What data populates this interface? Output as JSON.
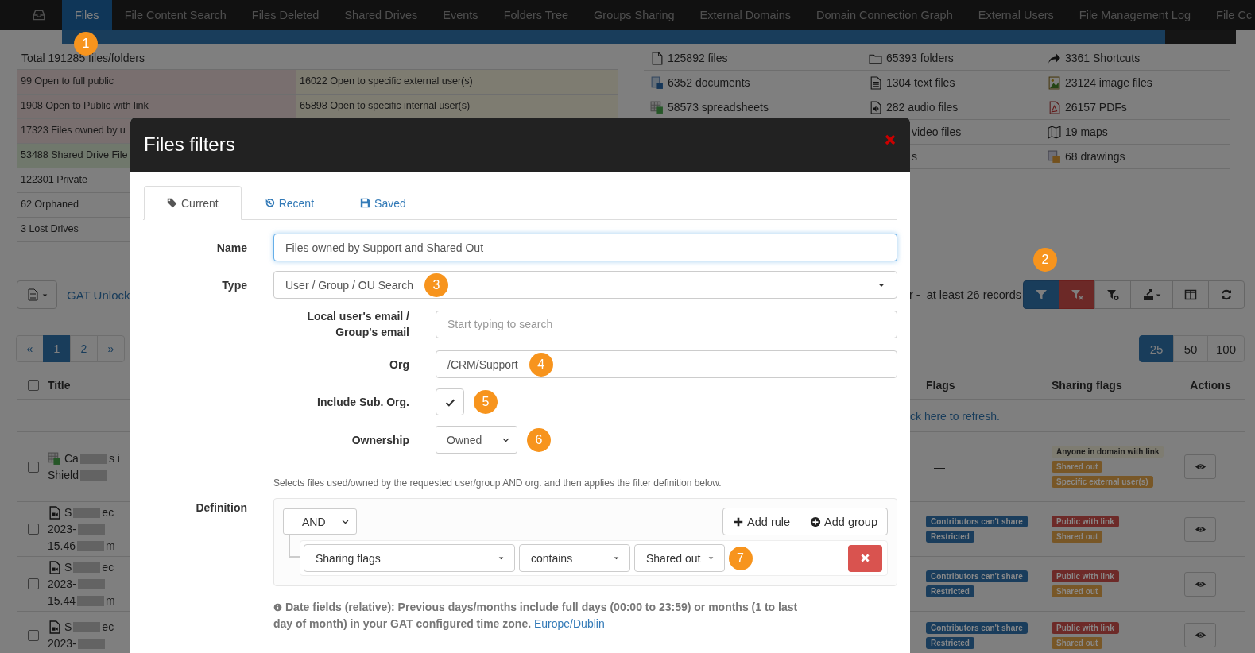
{
  "nav": {
    "marker": "1",
    "tabs": [
      {
        "label": "Files",
        "selected": true
      },
      {
        "label": "File Content Search",
        "selected": false
      },
      {
        "label": "Files Deleted",
        "selected": false
      },
      {
        "label": "Shared Drives",
        "selected": false
      },
      {
        "label": "Events",
        "selected": false
      },
      {
        "label": "Folders Tree",
        "selected": false
      },
      {
        "label": "Groups Sharing",
        "selected": false
      },
      {
        "label": "External Domains",
        "selected": false
      },
      {
        "label": "Domain Connection Graph",
        "selected": false
      },
      {
        "label": "External Users",
        "selected": false
      },
      {
        "label": "File Management Log",
        "selected": false
      },
      {
        "label": "File Cc",
        "selected": false
      }
    ]
  },
  "progress": {
    "level": 0.94
  },
  "summary": {
    "total": "Total 191285 files/folders",
    "sharing_stats": [
      {
        "cells": [
          {
            "text": "99 Open to full public",
            "color": "#796f6f"
          },
          {
            "text": "16022 Open to specific external user(s)",
            "color": "#7e7c71"
          }
        ]
      },
      {
        "cells": [
          {
            "text": "1908 Open to Public with link",
            "color": "#796f6f"
          },
          {
            "text": "65898 Open to specific internal user(s)",
            "color": "#7e7c71"
          }
        ]
      },
      {
        "cells": [
          {
            "text": "17323 Files owned by u",
            "color": "#796f6f"
          }
        ]
      },
      {
        "cells": [
          {
            "text": "53488 Shared Drive File",
            "color": "#70786c"
          }
        ]
      },
      {
        "cells": [
          {
            "text": "122301 Private"
          }
        ]
      },
      {
        "cells": [
          {
            "text": "62 Orphaned"
          }
        ]
      },
      {
        "cells": [
          {
            "text": "3 Lost Drives"
          }
        ]
      }
    ],
    "type_counts": [
      {
        "cells": [
          {
            "text": "125892 files",
            "kind": "file"
          },
          {
            "text": "65393 folders",
            "kind": "folder"
          },
          {
            "text": "3361 Shortcuts",
            "kind": "shortcut"
          }
        ]
      },
      {
        "cells": [
          {
            "text": "6352 documents",
            "kind": "document"
          },
          {
            "text": "1304 text files",
            "kind": "text"
          },
          {
            "text": "23124 image files",
            "kind": "image"
          }
        ]
      },
      {
        "cells": [
          {
            "text": "58573 spreadsheets",
            "kind": "spreadsheet"
          },
          {
            "text": "282 audio files",
            "kind": "audio"
          },
          {
            "text": "26157 PDFs",
            "kind": "pdf"
          }
        ]
      },
      {
        "cells": [
          {
            "text": "video files",
            "kind": "partial"
          },
          {
            "text": "19 maps",
            "kind": "map"
          }
        ]
      },
      {
        "cells": [
          {
            "text": "s",
            "kind": "partial"
          },
          {
            "text": "68 drawings",
            "kind": "drawing"
          }
        ]
      }
    ]
  },
  "toolbar": {
    "link": "GAT Unlock",
    "records": "r -  at least 26 records",
    "marker": "2",
    "buttons": [
      {
        "kind": "filter"
      },
      {
        "kind": "filter-clear"
      },
      {
        "kind": "filter-settings"
      },
      {
        "kind": "export"
      },
      {
        "kind": "columns"
      },
      {
        "kind": "refresh"
      }
    ]
  },
  "pagination": [
    {
      "label": "«",
      "selected": false
    },
    {
      "label": "1",
      "selected": true
    },
    {
      "label": "2",
      "selected": false
    },
    {
      "label": "»",
      "selected": false
    }
  ],
  "page_sizes": [
    {
      "label": "25",
      "selected": true
    },
    {
      "label": "50",
      "selected": false
    },
    {
      "label": "100",
      "selected": false
    }
  ],
  "table": {
    "columns": [
      "Title",
      "Flags",
      "Sharing flags",
      "Actions"
    ],
    "select_all": {
      "checked": false
    },
    "notice": "ck here to refresh.",
    "rows": [
      {
        "checked": false,
        "kind": "spreadsheet",
        "title_lines": [
          [
            "Ca",
            "s i"
          ],
          [
            "Shield"
          ]
        ],
        "flags_text": "—",
        "flags": [],
        "sharing": [
          {
            "text": "Anyone in domain with link",
            "color": "#7e7c71"
          },
          {
            "text": "Shared out",
            "color": "#785727"
          },
          {
            "text": "Specific external user(s)",
            "color": "#785727"
          }
        ]
      },
      {
        "checked": false,
        "kind": "video",
        "title_lines": [
          [
            "S",
            "ec"
          ],
          [
            "2023-"
          ],
          [
            "15.46",
            "m"
          ]
        ],
        "flags": [
          {
            "text": "Contributors can't share",
            "color": "#1a3d5c"
          },
          {
            "text": "Restricted",
            "color": "#1a3d5c"
          }
        ],
        "sharing": [
          {
            "text": "Public with link",
            "color": "#6d2a28"
          },
          {
            "text": "Shared out",
            "color": "#785727"
          }
        ]
      },
      {
        "checked": false,
        "kind": "video",
        "title_lines": [
          [
            "S",
            "ec"
          ],
          [
            "2023-"
          ],
          [
            "15.44",
            "m"
          ]
        ],
        "flags": [
          {
            "text": "Contributors can't share",
            "color": "#1a3d5c"
          },
          {
            "text": "Restricted",
            "color": "#1a3d5c"
          }
        ],
        "sharing": [
          {
            "text": "Public with link",
            "color": "#6d2a28"
          },
          {
            "text": "Shared out",
            "color": "#785727"
          }
        ]
      },
      {
        "checked": false,
        "kind": "video",
        "title_lines": [
          [
            "S",
            "ec"
          ],
          [
            "2023-"
          ]
        ],
        "flags": [
          {
            "text": "Contributors can't share",
            "color": "#1a3d5c"
          },
          {
            "text": "Restricted",
            "color": "#1a3d5c"
          }
        ],
        "sharing": [
          {
            "text": "Public with link",
            "color": "#6d2a28"
          },
          {
            "text": "Shared out",
            "color": "#785727"
          }
        ]
      }
    ]
  },
  "modal": {
    "title": "Files filters",
    "tabs": [
      {
        "label": "Current",
        "selected": true
      },
      {
        "label": "Recent",
        "selected": false
      },
      {
        "label": "Saved",
        "selected": false
      }
    ],
    "fields": [
      {
        "kind": "text",
        "label": "Name",
        "value": "Files owned by Support and Shared Out",
        "focused": true
      },
      {
        "kind": "select",
        "label": "Type",
        "value": "User / Group / OU Search",
        "marker": "3"
      }
    ],
    "sub_fields": [
      {
        "kind": "text",
        "label": "Local user's email / Group's email",
        "placeholder": "Start typing to search"
      },
      {
        "kind": "text",
        "label": "Org",
        "value": "/CRM/Support",
        "marker": "4"
      },
      {
        "kind": "checkbox",
        "label": "Include Sub. Org.",
        "checked": true,
        "marker": "5"
      },
      {
        "kind": "native-select",
        "label": "Ownership",
        "value": "Owned",
        "marker": "6"
      }
    ],
    "help": "Selects files used/owned by the requested user/group AND org. and then applies the filter definition below.",
    "definition": {
      "label": "Definition",
      "condition": "AND",
      "buttons": [
        {
          "kind": "add-rule",
          "label": "Add rule"
        },
        {
          "kind": "add-group",
          "label": "Add group"
        }
      ],
      "rule": {
        "field": "Sharing flags",
        "operator": "contains",
        "value": "Shared out",
        "marker": "7"
      }
    },
    "note": {
      "text": "Date fields (relative): Previous days/months include full days (00:00 to 23:59) or months (1 to last day of month) in your GAT configured time zone.",
      "link": "Europe/Dublin"
    }
  }
}
